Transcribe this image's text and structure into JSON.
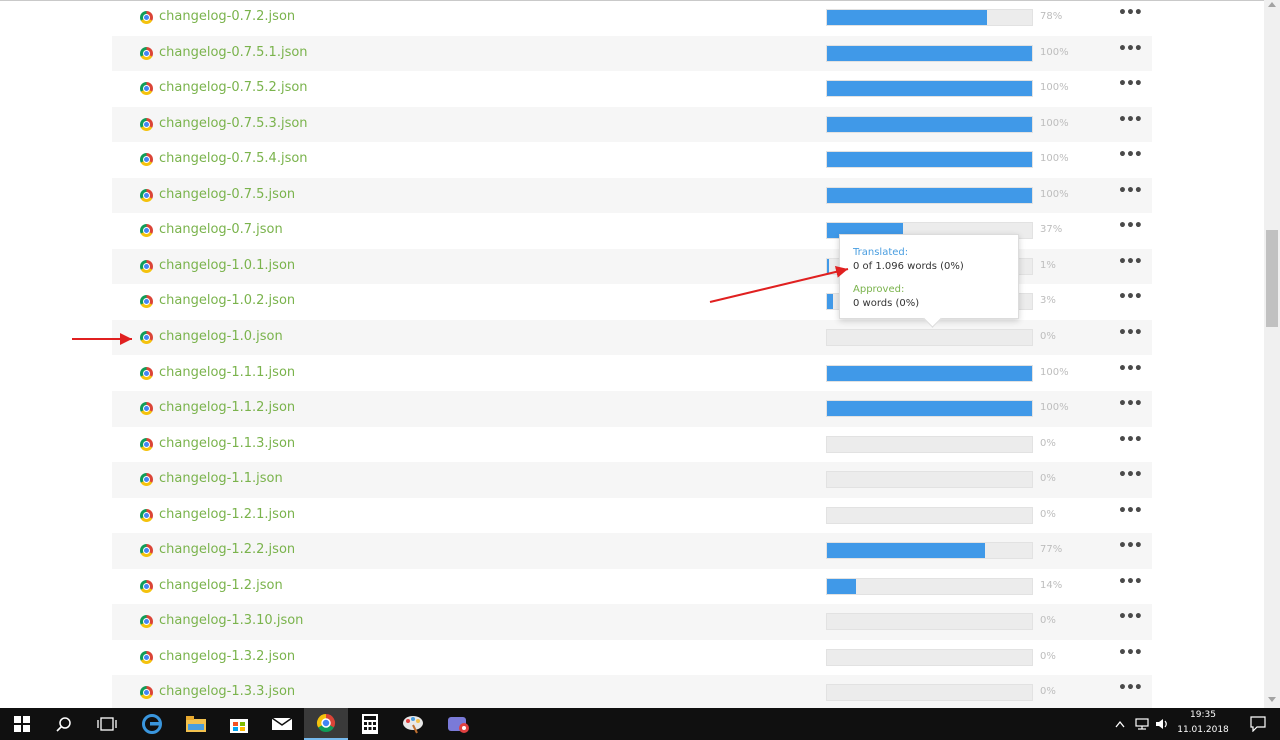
{
  "files": [
    {
      "name": "changelog-0.7.2.json",
      "progress": 78,
      "percent": "78%"
    },
    {
      "name": "changelog-0.7.5.1.json",
      "progress": 100,
      "percent": "100%"
    },
    {
      "name": "changelog-0.7.5.2.json",
      "progress": 100,
      "percent": "100%"
    },
    {
      "name": "changelog-0.7.5.3.json",
      "progress": 100,
      "percent": "100%"
    },
    {
      "name": "changelog-0.7.5.4.json",
      "progress": 100,
      "percent": "100%"
    },
    {
      "name": "changelog-0.7.5.json",
      "progress": 100,
      "percent": "100%"
    },
    {
      "name": "changelog-0.7.json",
      "progress": 37,
      "percent": "37%"
    },
    {
      "name": "changelog-1.0.1.json",
      "progress": 1,
      "percent": "1%"
    },
    {
      "name": "changelog-1.0.2.json",
      "progress": 3,
      "percent": "3%"
    },
    {
      "name": "changelog-1.0.json",
      "progress": 0,
      "percent": "0%"
    },
    {
      "name": "changelog-1.1.1.json",
      "progress": 100,
      "percent": "100%"
    },
    {
      "name": "changelog-1.1.2.json",
      "progress": 100,
      "percent": "100%"
    },
    {
      "name": "changelog-1.1.3.json",
      "progress": 0,
      "percent": "0%"
    },
    {
      "name": "changelog-1.1.json",
      "progress": 0,
      "percent": "0%"
    },
    {
      "name": "changelog-1.2.1.json",
      "progress": 0,
      "percent": "0%"
    },
    {
      "name": "changelog-1.2.2.json",
      "progress": 77,
      "percent": "77%"
    },
    {
      "name": "changelog-1.2.json",
      "progress": 14,
      "percent": "14%"
    },
    {
      "name": "changelog-1.3.10.json",
      "progress": 0,
      "percent": "0%"
    },
    {
      "name": "changelog-1.3.2.json",
      "progress": 0,
      "percent": "0%"
    },
    {
      "name": "changelog-1.3.3.json",
      "progress": 0,
      "percent": "0%"
    }
  ],
  "row_menu_label": "•••",
  "tooltip": {
    "translated_label": "Translated:",
    "translated_value": "0 of 1.096 words (0%)",
    "approved_label": "Approved:",
    "approved_value": "0 words (0%)"
  },
  "colors": {
    "progress_fill": "#4099e8",
    "file_link": "#7ab34c",
    "annotation_arrow": "#e02020"
  },
  "taskbar": {
    "apps": [
      "windows-start-icon",
      "search-icon",
      "task-view-icon",
      "edge-icon",
      "file-explorer-icon",
      "store-icon",
      "mail-icon",
      "chrome-icon",
      "calculator-icon",
      "paint-icon",
      "app-icon"
    ],
    "clock_time": "19:35",
    "clock_date": "11.01.2018"
  }
}
